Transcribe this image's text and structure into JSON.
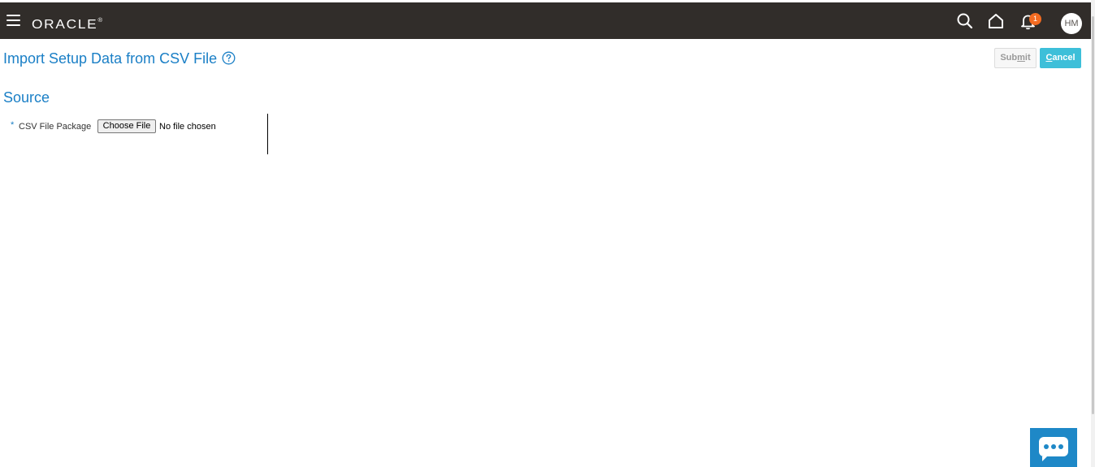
{
  "header": {
    "logo_text": "ORACLE",
    "logo_mark": "®",
    "icons": [
      "hamburger-menu-icon",
      "search-icon",
      "home-icon",
      "bell-icon"
    ],
    "notification_count": "1",
    "avatar_initials": "HM"
  },
  "page": {
    "title": "Import Setup Data from CSV File",
    "submit_label_pre": "Sub",
    "submit_label_key": "m",
    "submit_label_post": "it",
    "cancel_label_key": "C",
    "cancel_label_post": "ancel"
  },
  "source": {
    "section_title": "Source",
    "required_marker": "*",
    "csv_label": "CSV File Package",
    "choose_file_label": "Choose File",
    "file_status": "No file chosen"
  },
  "colors": {
    "topbar": "#312d2a",
    "title_blue": "#1a7fc6",
    "cancel_button": "#3dbfd9",
    "notification_badge": "#f36b21",
    "chat_widget": "#1e88c7"
  }
}
